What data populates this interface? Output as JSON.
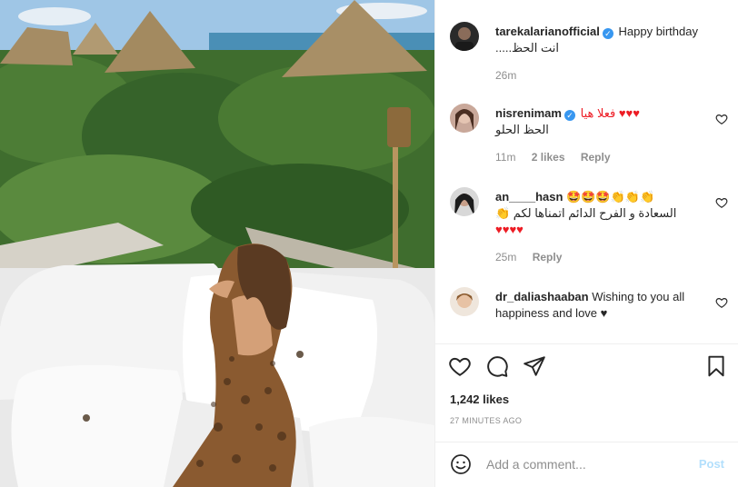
{
  "post": {
    "image_alt": "Woman in leopard print dress sitting on white cushions overlooking jungle huts and sea",
    "likes": "1,242 likes",
    "time_ago": "27 MINUTES AGO"
  },
  "caption": {
    "username": "tarekalarianofficial",
    "verified": true,
    "text_en": "Happy birthday",
    "text_ar": "انت الحظ.....",
    "time": "26m"
  },
  "comments": [
    {
      "username": "nisrenimam",
      "verified": true,
      "text_line1": "♥♥♥ فعلا هيا",
      "text_line2": "الحظ الحلو",
      "time": "11m",
      "likes": "2 likes",
      "reply": "Reply"
    },
    {
      "username": "an____hasn",
      "verified": false,
      "text_line1": "🤩🤩🤩👏👏👏",
      "text_line2": "السعادة و الفرح الدائم اتمناها لكم 👏",
      "text_line3": "♥♥♥♥",
      "time": "25m",
      "reply": "Reply"
    },
    {
      "username": "dr_daliashaaban",
      "verified": false,
      "text_line1": "Wishing to you all",
      "text_line2": "happiness and love ♥",
      "time": "",
      "reply": ""
    }
  ],
  "composer": {
    "placeholder": "Add a comment...",
    "post_label": "Post"
  },
  "icons": {
    "like": "heart-outline-icon",
    "comment": "speech-bubble-icon",
    "share": "paper-plane-icon",
    "save": "bookmark-icon",
    "emoji": "smiley-icon"
  },
  "colors": {
    "verified": "#3897f0",
    "heart": "#ed1c24",
    "post_disabled": "#b2dffc",
    "meta_gray": "#8e8e8e"
  }
}
